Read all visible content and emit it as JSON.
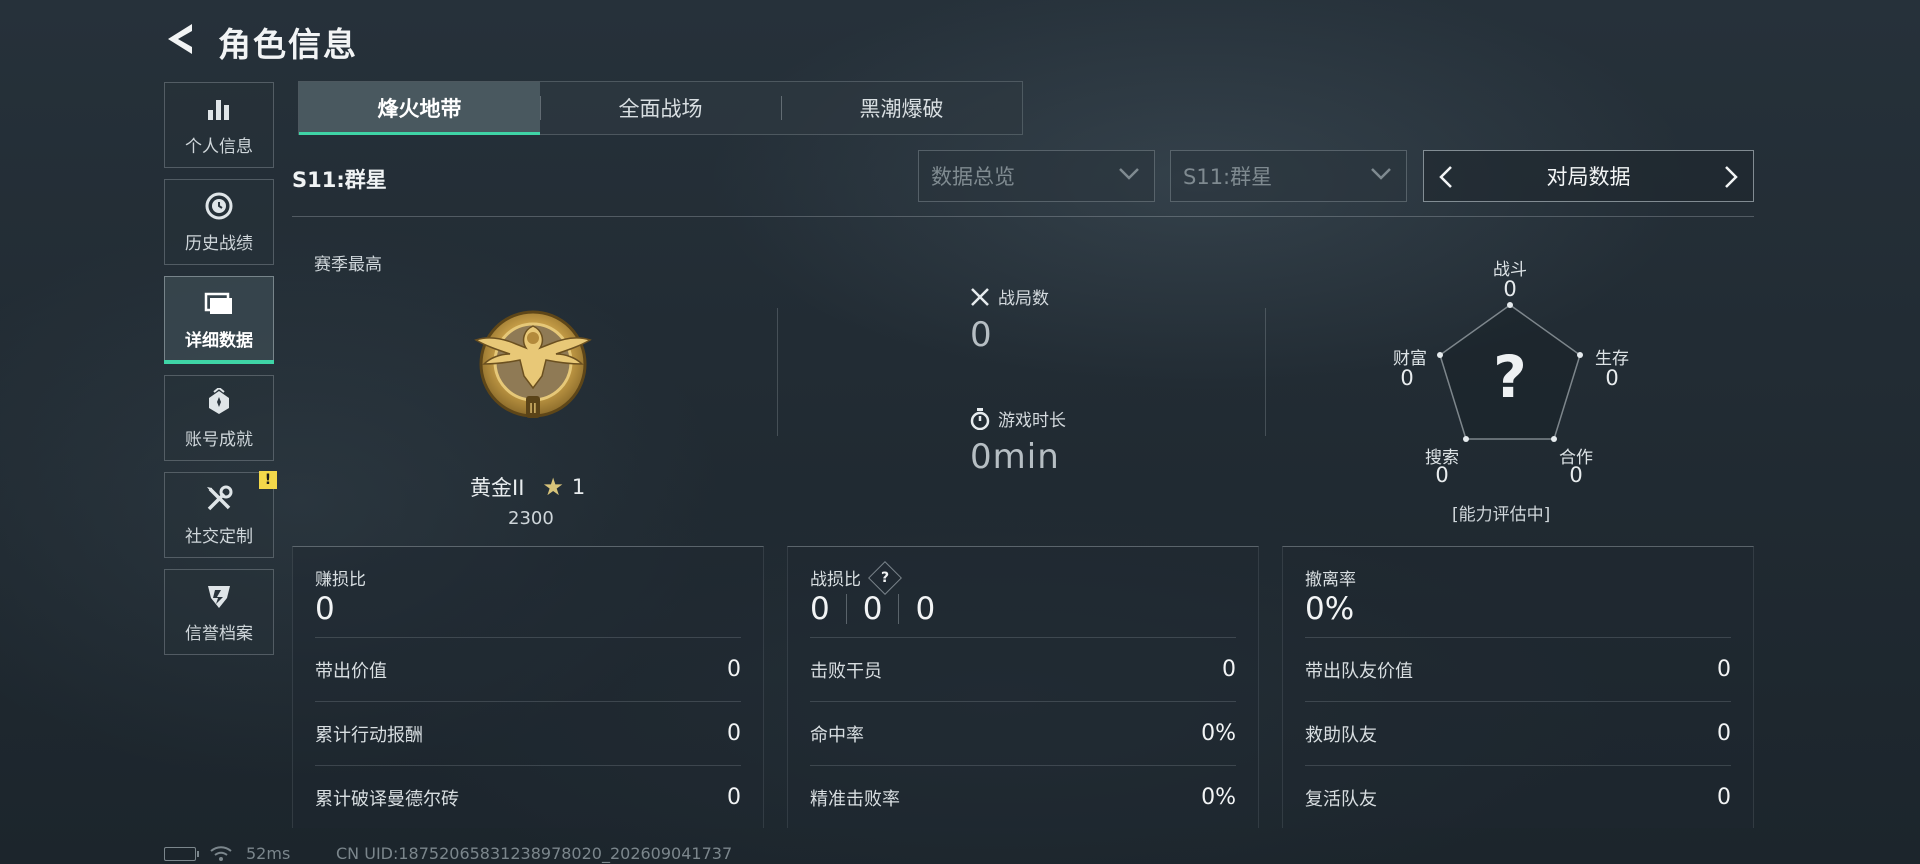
{
  "header": {
    "title": "角色信息",
    "back_icon": "back-arrow-icon"
  },
  "sidebar": {
    "items": [
      {
        "label": "个人信息",
        "icon": "bar-chart-icon",
        "active": false
      },
      {
        "label": "历史战绩",
        "icon": "clock-icon",
        "active": false
      },
      {
        "label": "详细数据",
        "icon": "folder-icon",
        "active": true
      },
      {
        "label": "账号成就",
        "icon": "achievement-icon",
        "active": false
      },
      {
        "label": "社交定制",
        "icon": "tools-icon",
        "active": false,
        "badge": "!"
      },
      {
        "label": "信誉档案",
        "icon": "credit-shield-icon",
        "active": false
      }
    ]
  },
  "tabs": [
    {
      "label": "烽火地带",
      "active": true
    },
    {
      "label": "全面战场",
      "active": false
    },
    {
      "label": "黑潮爆破",
      "active": false
    }
  ],
  "season": {
    "label": "S11:群星"
  },
  "filters": {
    "data_select": "数据总览",
    "season_select": "S11:群星",
    "pager_label": "对局数据"
  },
  "rank": {
    "caption": "赛季最高",
    "tier": "黄金II",
    "stars": "1",
    "score": "2300"
  },
  "overview": {
    "matches_label": "战局数",
    "matches_value": "0",
    "playtime_label": "游戏时长",
    "playtime_value": "0min"
  },
  "radar": {
    "center": "?",
    "axes": [
      {
        "label": "战斗",
        "value": "0"
      },
      {
        "label": "生存",
        "value": "0"
      },
      {
        "label": "合作",
        "value": "0"
      },
      {
        "label": "搜索",
        "value": "0"
      },
      {
        "label": "财富",
        "value": "0"
      }
    ],
    "status": "[能力评估中]"
  },
  "panels": {
    "profit": {
      "title": "赚损比",
      "value": "0",
      "rows": [
        {
          "label": "带出价值",
          "value": "0"
        },
        {
          "label": "累计行动报酬",
          "value": "0"
        },
        {
          "label": "累计破译曼德尔砖",
          "value": "0"
        }
      ]
    },
    "kd": {
      "title": "战损比",
      "help": "?",
      "values": [
        "0",
        "0",
        "0"
      ],
      "rows": [
        {
          "label": "击败干员",
          "value": "0"
        },
        {
          "label": "命中率",
          "value": "0%"
        },
        {
          "label": "精准击败率",
          "value": "0%"
        }
      ]
    },
    "extract": {
      "title": "撤离率",
      "value": "0%",
      "rows": [
        {
          "label": "带出队友价值",
          "value": "0"
        },
        {
          "label": "救助队友",
          "value": "0"
        },
        {
          "label": "复活队友",
          "value": "0"
        }
      ]
    }
  },
  "statusbar": {
    "ping": "52ms",
    "uid": "CN UID:18752065831238978020_202609041737"
  },
  "colors": {
    "accent": "#3fd4a6",
    "warning": "#f3d84a",
    "gold": "#c9a24a"
  }
}
